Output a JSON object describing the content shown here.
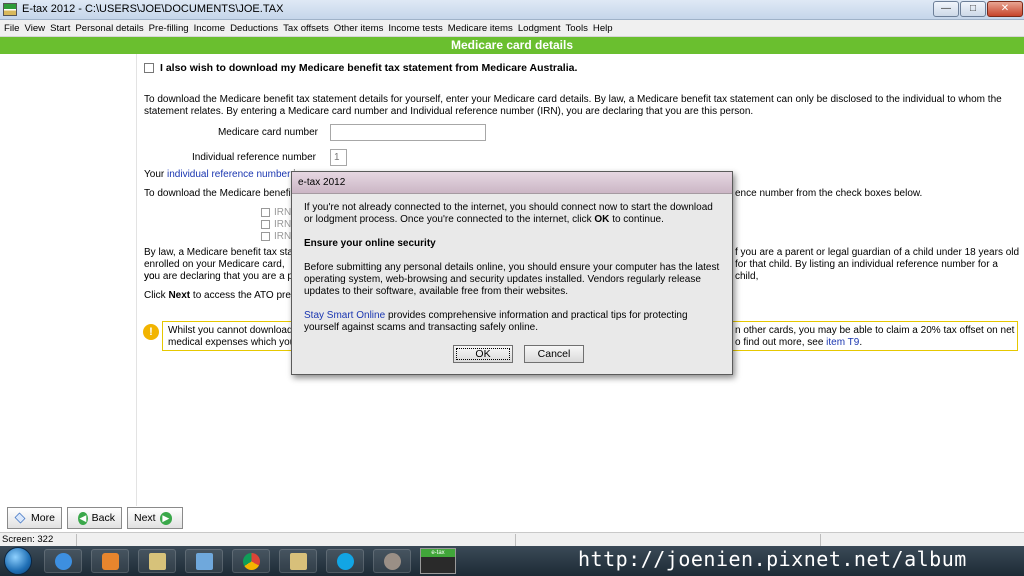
{
  "window": {
    "title": "E-tax 2012 - C:\\USERS\\JOE\\DOCUMENTS\\JOE.TAX",
    "controls": {
      "minimize": "—",
      "maximize": "□",
      "close": "✕"
    }
  },
  "menu": [
    "File",
    "View",
    "Start",
    "Personal details",
    "Pre-filling",
    "Income",
    "Deductions",
    "Tax offsets",
    "Other items",
    "Income tests",
    "Medicare items",
    "Lodgment",
    "Tools",
    "Help"
  ],
  "section": {
    "title": "Medicare card details"
  },
  "content": {
    "download_checkbox_label": "I also wish to download my Medicare benefit tax statement from Medicare Australia.",
    "intro_para": "To download the Medicare benefit tax statement details for yourself, enter your Medicare card details. By law, a Medicare benefit tax statement can only be disclosed to the individual to whom the statement relates. By entering a Medicare card number and Individual reference number (IRN), you are declaring that you are this person.",
    "card_number_label": "Medicare card number",
    "card_number_value": "",
    "irn_label": "Individual reference number",
    "irn_value": "1",
    "irn_line_prefix": "Your",
    "irn_line_link": "individual reference number",
    "irn_line_rest": "i",
    "download_line_left": "To download the Medicare benefit",
    "download_line_right": "ence number from the check boxes below.",
    "irn_boxes": [
      "IRN",
      "IRN",
      "IRN"
    ],
    "law_left_1": "By law, a Medicare benefit tax sta",
    "law_right_1": "f you are a parent or legal guardian of a child under 18 years old",
    "law_left_2": "enrolled on your Medicare card, yo",
    "law_right_2": "for that child. By listing an individual reference number for a child,",
    "law_left_3": "you are declaring that you are a p",
    "click_prefix": "Click",
    "click_bold": "Next",
    "click_rest": "to access the ATO pre",
    "info_left_1": "Whilst you cannot download",
    "info_right_1": "n other cards, you may be able to claim a 20% tax offset on net",
    "info_left_2": "medical expenses which you",
    "info_right_2": "o find out more, see",
    "info_link": "item T9",
    "info_end": "."
  },
  "dialog": {
    "title": "e-tax 2012",
    "para1_a": "If you're not already connected to the internet, you should connect now to start the download or lodgment process. Once you're connected to the internet, click",
    "para1_bold": "OK",
    "para1_b": "to continue.",
    "heading": "Ensure your online security",
    "para2": "Before submitting any personal details online, you should ensure your computer has the latest operating system, web-browsing and security updates installed. Vendors regularly release updates to their software, available free from their websites.",
    "link": "Stay Smart Online",
    "para3": "provides comprehensive information and practical tips for protecting yourself against scams and transacting safely online.",
    "ok_label": "OK",
    "cancel_label": "Cancel"
  },
  "nav": {
    "more": "More",
    "back": "Back",
    "next": "Next"
  },
  "status": {
    "text": "Screen: 322"
  },
  "taskbar": {
    "icons": [
      "ie-icon",
      "media-player-icon",
      "folder-icon",
      "paint-icon",
      "chrome-icon",
      "folder-icon",
      "skype-icon",
      "tools-icon"
    ],
    "etax_label": "e-tax"
  },
  "watermark": "http://joenien.pixnet.net/album",
  "colors": {
    "section_green": "#6abf2f",
    "link_blue": "#1a36b0",
    "info_yellow": "#e6c800"
  }
}
